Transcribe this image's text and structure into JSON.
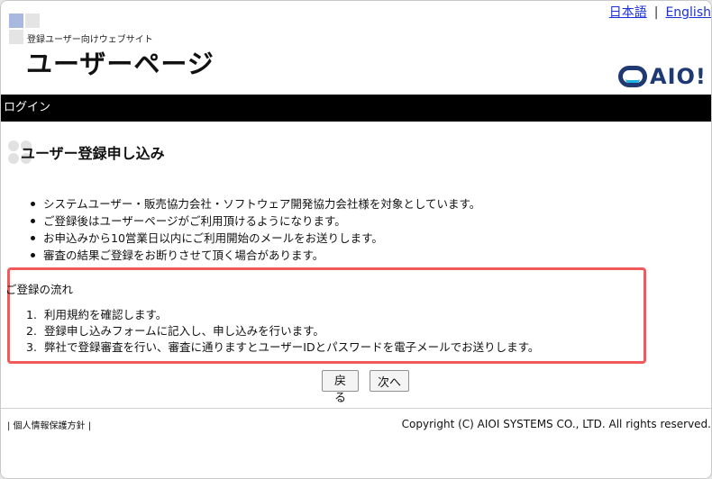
{
  "header": {
    "site_subtitle": "登録ユーザー向けウェブサイト",
    "site_title": "ユーザーページ",
    "lang_japanese": "日本語",
    "lang_separator": "|",
    "lang_english": "English",
    "brand_text": "AIO!"
  },
  "nav": {
    "login": "ログイン"
  },
  "main": {
    "heading": "ユーザー登録申し込み",
    "bullets": [
      "システムユーザー・販売協力会社・ソフトウェア開発協力会社様を対象としています。",
      "ご登録後はユーザーページがご利用頂けるようになります。",
      "お申込みから10営業日以内にご利用開始のメールをお送りします。",
      "審査の結果ご登録をお断りさせて頂く場合があります。"
    ],
    "flow_title": "ご登録の流れ",
    "steps": [
      {
        "num": "1.",
        "text": "利用規約を確認します。"
      },
      {
        "num": "2.",
        "text": "登録申し込みフォームに記入し、申し込みを行います。"
      },
      {
        "num": "3.",
        "text": "弊社で登録審査を行い、審査に通りますとユーザーIDとパスワードを電子メールでお送りします。"
      }
    ],
    "back_button": "戻る",
    "next_button": "次へ"
  },
  "footer": {
    "privacy": "| 個人情報保護方針 |",
    "copyright": "Copyright (C) AIOI SYSTEMS CO., LTD. All rights reserved."
  },
  "colors": {
    "highlight_border": "#f05a5a",
    "link": "#1a2fd6",
    "navbar": "#000000",
    "brand": "#1f3a73"
  }
}
